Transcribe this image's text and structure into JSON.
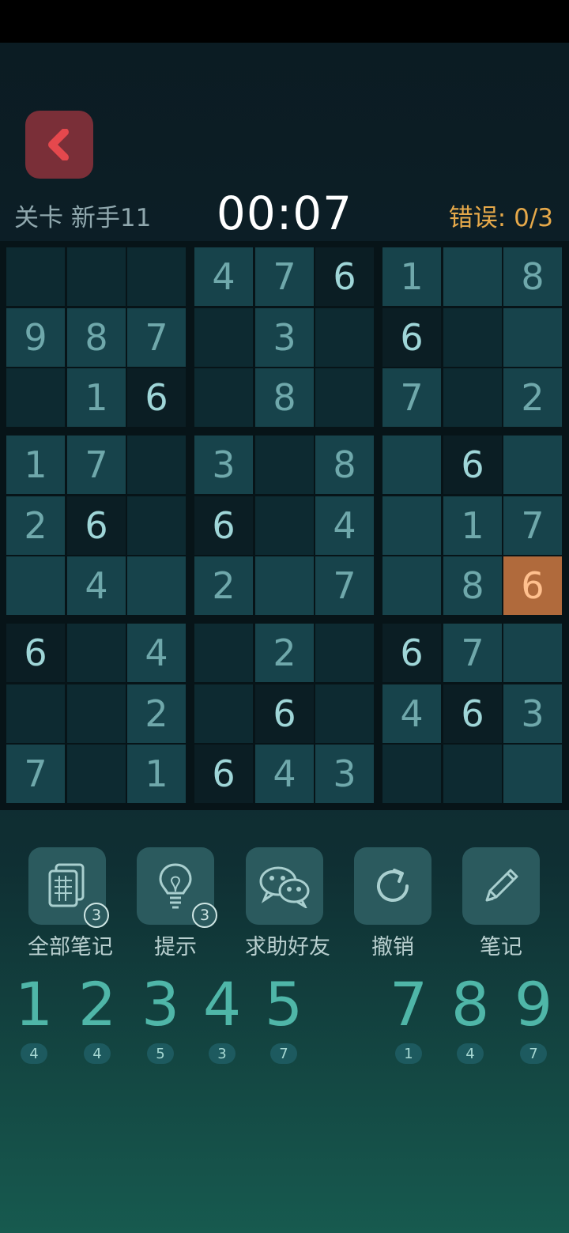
{
  "header": {
    "level": "关卡 新手11",
    "timer": "00:07",
    "errors": "错误: 0/3"
  },
  "board": {
    "rows": [
      [
        "",
        "",
        "",
        "4",
        "7",
        "6",
        "1",
        "",
        "8"
      ],
      [
        "9",
        "8",
        "7",
        "",
        "3",
        "",
        "6",
        "",
        ""
      ],
      [
        "",
        "1",
        "6",
        "",
        "8",
        "",
        "7",
        "",
        "2"
      ],
      [
        "1",
        "7",
        "",
        "3",
        "",
        "8",
        "",
        "6",
        ""
      ],
      [
        "2",
        "6",
        "",
        "6",
        "",
        "4",
        "",
        "1",
        "7"
      ],
      [
        "",
        "4",
        "",
        "2",
        "",
        "7",
        "",
        "8",
        "6"
      ],
      [
        "6",
        "",
        "4",
        "",
        "2",
        "",
        "6",
        "7",
        ""
      ],
      [
        "",
        "",
        "2",
        "",
        "6",
        "",
        "4",
        "6",
        "3"
      ],
      [
        "7",
        "",
        "1",
        "6",
        "4",
        "3",
        "",
        "",
        ""
      ]
    ],
    "selected": [
      5,
      8
    ],
    "selected_value": "6"
  },
  "tools": [
    {
      "label": "全部笔记",
      "icon": "notes-all-icon",
      "badge": "3"
    },
    {
      "label": "提示",
      "icon": "lightbulb-icon",
      "badge": "3"
    },
    {
      "label": "求助好友",
      "icon": "wechat-icon",
      "badge": ""
    },
    {
      "label": "撤销",
      "icon": "undo-icon",
      "badge": ""
    },
    {
      "label": "笔记",
      "icon": "pencil-icon",
      "badge": ""
    }
  ],
  "numpad": [
    {
      "digit": "1",
      "count": "4"
    },
    {
      "digit": "2",
      "count": "4"
    },
    {
      "digit": "3",
      "count": "5"
    },
    {
      "digit": "4",
      "count": "3"
    },
    {
      "digit": "5",
      "count": "7"
    },
    {
      "digit": "",
      "count": ""
    },
    {
      "digit": "7",
      "count": "1"
    },
    {
      "digit": "8",
      "count": "4"
    },
    {
      "digit": "9",
      "count": "7"
    }
  ],
  "colors": {
    "accent": "#4fb6a8",
    "selected_cell": "#b06a3c",
    "error_text": "#e6a94a",
    "back_button": "#7a2f38"
  }
}
